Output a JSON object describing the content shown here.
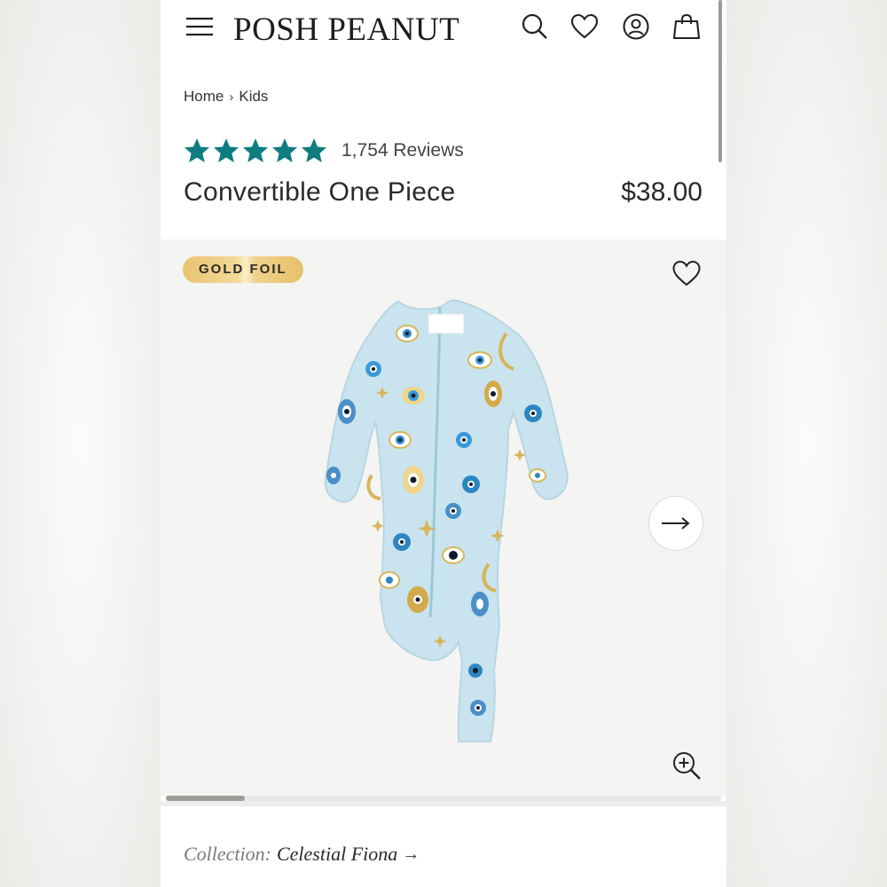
{
  "header": {
    "brand": "POSH PEANUT",
    "icons": [
      "menu-icon",
      "search-icon",
      "heart-icon",
      "account-icon",
      "shopping-bag-icon"
    ]
  },
  "breadcrumb": {
    "home": "Home",
    "separator": "›",
    "current": "Kids"
  },
  "product": {
    "rating_stars": 5,
    "reviews": "1,754 Reviews",
    "title": "Convertible One Piece",
    "price": "$38.00"
  },
  "gallery": {
    "badge": "GOLD FOIL",
    "image_position": 1,
    "image_count": 7,
    "icons": [
      "heart-icon",
      "arrow-right-icon",
      "zoom-in-icon"
    ]
  },
  "collection": {
    "label": "Collection:",
    "name": "Celestial Fiona",
    "arrow": "→"
  },
  "colors": {
    "star": "#0f7c80",
    "badge_gold": "#ecc97a",
    "text": "#2a2a2a",
    "muted": "#7a7a7a"
  }
}
